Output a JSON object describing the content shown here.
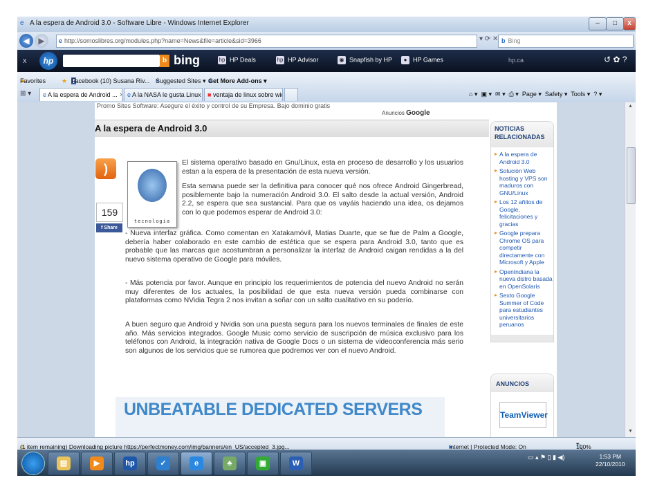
{
  "window": {
    "title": "A la espera de Android 3.0 - Software Libre - Windows Internet Explorer",
    "minimize": "–",
    "maximize": "□",
    "close": "x"
  },
  "address": {
    "url": "http://somoslibres.org/modules.php?name=News&file=article&sid=3966",
    "search_placeholder": "Bing"
  },
  "hp_toolbar": {
    "bing": "bing",
    "items": [
      "HP Deals",
      "HP Advisor",
      "Snapfish by HP",
      "HP Games"
    ],
    "weather": "hp.ca"
  },
  "favorites_bar": {
    "favorites": "Favorites",
    "links": [
      "Facebook (10)  Susana Riv...",
      "Suggested Sites ▾",
      "Get More Add-ons ▾"
    ]
  },
  "tabs": [
    {
      "label": "A la espera de Android ...",
      "active": true
    },
    {
      "label": "A la NASA le gusta Linux « ...",
      "active": false
    },
    {
      "label": "ventaja de linux sobre wid...",
      "active": false
    }
  ],
  "tab_tools": [
    "Page ▾",
    "Safety ▾",
    "Tools ▾"
  ],
  "page": {
    "top_snippet": "Promo Sites Software: Asegure el éxito y control de su Empresa. Bajo dominio gratis",
    "ads_label": "Anuncios",
    "ads_brand": "Google",
    "article_title": "A la espera de Android 3.0",
    "count": "159",
    "share": "Share",
    "image_caption": "tecnologia",
    "paragraphs": [
      "El sistema operativo basado en Gnu/Linux, esta en proceso de desarrollo y los usuarios estan a la espera de la presentación de esta nueva versión.",
      "Esta semana puede ser la definitiva para conocer qué nos ofrece Android Gingerbread, posiblemente bajo la numeración Android 3.0. El salto desde la actual versión, Android 2.2, se espera que sea sustancial. Para que os vayáis haciendo una idea, os dejamos con lo que podemos esperar de Android 3.0:",
      "- Nueva interfaz gráfica. Como comentan en Xatakamóvil, Matias Duarte, que se fue de Palm a Google, debería haber colaborado en este cambio de estética que se espera para Android 3.0, tanto que es probable que las marcas que acostumbran a personalizar la interfaz de Android caigan rendidas a la del nuevo sistema operativo de Google para móviles.",
      "- Más potencia por favor. Aunque en principio los requerimientos de potencia del nuevo Android no serán muy diferentes de los actuales, la posibilidad de que esta nueva versión pueda combinarse con plataformas como NVidia Tegra 2 nos invitan a soñar con un salto cualitativo en su poderío.",
      "A buen seguro que Android y Nvidia son una puesta segura para los nuevos terminales de finales de este año. Más servicios integrados. Google Music como servicio de suscripción de música exclusivo para los teléfonos con Android, la integración nativa de Google Docs o un sistema de videoconferencia más serio son algunos de los servicios que se rumorea que podremos ver con el nuevo Android."
    ],
    "banner": "UNBEATABLE DEDICATED SERVERS",
    "sidebar": {
      "title": "NOTICIAS RELACIONADAS",
      "items": [
        "A la espera de Android 3.0",
        "Solución Web hosting y VPS son maduros con GNU/Linux",
        "Los 12 añitos de Google, felicitaciones y gracias",
        "Google prepara Chrome OS para competir directamente con Microsoft y Apple",
        "OpenIndiana la nueva distro basada en OpenSolaris",
        "Sexto Google Summer of Code para estudiantes universitarios peruanos"
      ]
    },
    "anuncios": {
      "title": "ANUNCIOS",
      "teamviewer": "TeamViewer"
    }
  },
  "status": {
    "text": "(1 item remaining) Downloading picture https://perfectmoney.com/img/banners/en_US/accepted_3.jpg...",
    "zone": "Internet | Protected Mode: On",
    "zoom": "100%"
  },
  "clock": {
    "time": "1:53 PM",
    "date": "22/10/2010"
  },
  "colors": {
    "accent": "#3f88c9",
    "sidebar_link": "#1d57b0",
    "rss": "#e2620f"
  }
}
